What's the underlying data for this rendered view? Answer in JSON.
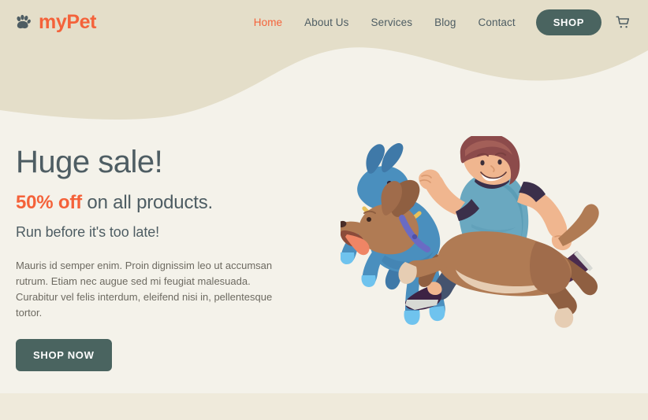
{
  "colors": {
    "page_background": "#f4f2ea",
    "header_band": "#e4dec9",
    "bottom_band": "#efeadb",
    "accent": "#f4623a",
    "dark_slate": "#4e5d63",
    "button_green": "#4a6460",
    "body_text": "#6d6a61"
  },
  "navbar": {
    "brand": {
      "icon": "paw-print-icon",
      "text": "myPet"
    },
    "links": [
      {
        "label": "Home",
        "active": true
      },
      {
        "label": "About Us",
        "active": false
      },
      {
        "label": "Services",
        "active": false
      },
      {
        "label": "Blog",
        "active": false
      },
      {
        "label": "Contact",
        "active": false
      }
    ],
    "shop_button_label": "SHOP",
    "cart_icon": "shopping-cart-icon"
  },
  "hero": {
    "title": "Huge sale!",
    "subtitle_accent": "50% off",
    "subtitle_rest": " on all products.",
    "tagline": "Run before it's too late!",
    "paragraph": "Mauris id semper enim. Proin dignissim leo ut accumsan rutrum. Etiam nec augue sed mi feugiat malesuada. Curabitur vel felis interdum, eleifend nisi in, pellentesque tortor.",
    "cta_label": "SHOP NOW",
    "illustration": {
      "name": "boy-running-with-two-dogs-illustration",
      "figures": [
        "running-boy",
        "blue-dog",
        "brown-dog"
      ],
      "colors": {
        "boy_hair": "#8c4b4b",
        "boy_skin": "#f0b68f",
        "boy_shirt": "#6aa8c0",
        "boy_jeans": "#44536e",
        "boy_shoes": "#4a2b4e",
        "blue_dog_body": "#4a8fbe",
        "blue_dog_ear": "#3f79a8",
        "blue_dog_paw": "#6fc3ee",
        "blue_dog_collar": "#e8c15a",
        "blue_dog_tongue": "#93334a",
        "brown_dog_body": "#b07b54",
        "brown_dog_belly": "#e6cdb3",
        "brown_dog_collar": "#6a6bc4",
        "brown_dog_tongue": "#ef8565"
      }
    }
  }
}
